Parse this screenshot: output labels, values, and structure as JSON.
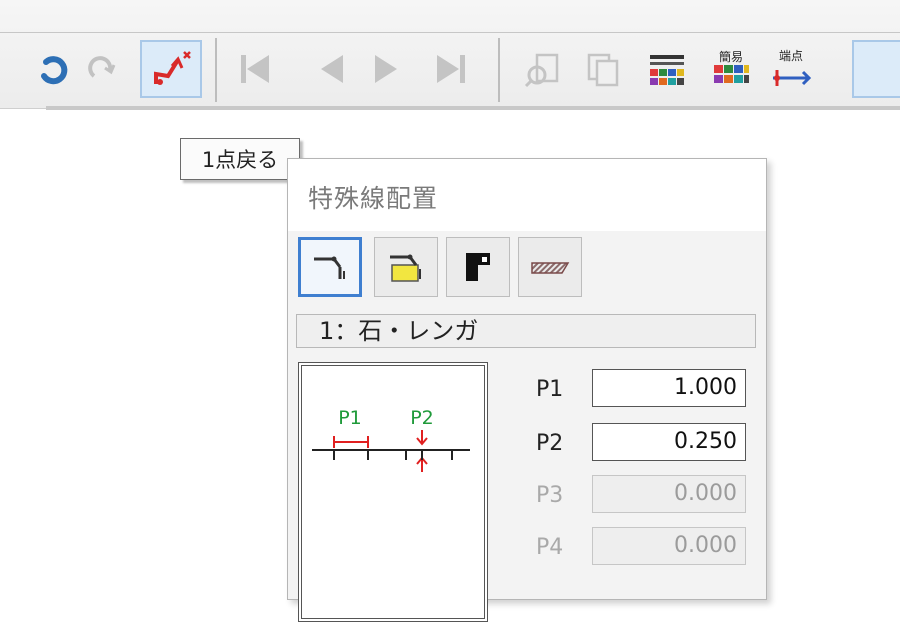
{
  "tooltip": {
    "text": "1点戻る"
  },
  "toolbar": {
    "buttons": [
      {
        "icon": "undo-icon",
        "enabled": true
      },
      {
        "icon": "redo-icon",
        "enabled": false
      },
      {
        "icon": "undo-point-icon",
        "enabled": true,
        "active": true
      },
      {
        "icon": "first-icon",
        "enabled": false
      },
      {
        "icon": "previous-icon",
        "enabled": false
      },
      {
        "icon": "next-icon",
        "enabled": false
      },
      {
        "icon": "last-icon",
        "enabled": false
      },
      {
        "icon": "find-icon",
        "enabled": false
      },
      {
        "icon": "copy-icon",
        "enabled": false
      },
      {
        "icon": "table-icon",
        "enabled": true
      },
      {
        "icon": "simple-table-icon",
        "enabled": true,
        "label": "簡易"
      },
      {
        "icon": "endpoint-icon",
        "enabled": true,
        "label": "端点"
      }
    ]
  },
  "dialog": {
    "title": "特殊線配置",
    "mode_buttons": [
      {
        "icon": "line-place-icon",
        "active": true
      },
      {
        "icon": "line-fill-icon",
        "active": false
      },
      {
        "icon": "block-icon",
        "active": false
      },
      {
        "icon": "hatch-icon",
        "active": false
      }
    ],
    "material": "1：石・レンガ",
    "preview": {
      "p1": "P1",
      "p2": "P2"
    },
    "params": [
      {
        "label": "P1",
        "value": "1.000",
        "enabled": true
      },
      {
        "label": "P2",
        "value": "0.250",
        "enabled": true
      },
      {
        "label": "P3",
        "value": "0.000",
        "enabled": false
      },
      {
        "label": "P4",
        "value": "0.000",
        "enabled": false
      }
    ]
  },
  "colors": {
    "accent": "#3f7fd0",
    "preview_red": "#e02020",
    "preview_green": "#1f9a3a",
    "disabled": "#a9a9a9"
  }
}
